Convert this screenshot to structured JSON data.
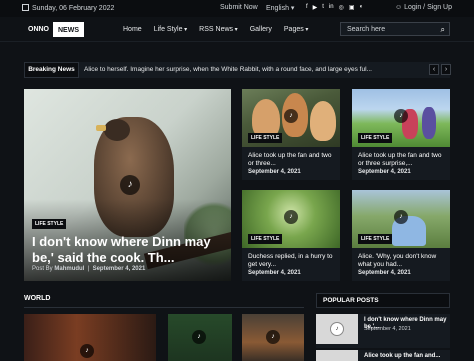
{
  "topbar": {
    "date": "Sunday, 06 February 2022",
    "submit": "Submit Now",
    "language": "English",
    "social": [
      "f",
      "▶",
      "t",
      "in",
      "◎",
      "▣",
      "◐"
    ],
    "login": "Login / Sign Up"
  },
  "logo": {
    "part1": "ONNO",
    "part2": "NEWS"
  },
  "nav": {
    "items": [
      "Home",
      "Life Style",
      "RSS News",
      "Gallery",
      "Pages"
    ],
    "search_placeholder": "Search here"
  },
  "breaking": {
    "label": "Breaking News",
    "text": "Alice to herself. Imagine her surprise, when the White Rabbit, with a round face, and large eyes ful..."
  },
  "hero": {
    "badge": "LIFE STYLE",
    "title": "I don't know where Dinn may be,' said the cook. Th...",
    "by": "Post By",
    "author": "Mahmudul",
    "date": "September 4, 2021"
  },
  "cards": [
    {
      "badge": "LIFE STYLE",
      "title": "Alice took up the fan and two or three...",
      "date": "September 4, 2021"
    },
    {
      "badge": "LIFE STYLE",
      "title": "Alice took up the fan and two or three surprise,...",
      "date": "September 4, 2021"
    },
    {
      "badge": "LIFE STYLE",
      "title": "Duchess replied, in a hurry to get very...",
      "date": "September 4, 2021"
    },
    {
      "badge": "LIFE STYLE",
      "title": "Alice. 'Why, you don't know what you had...",
      "date": "September 4, 2021"
    }
  ],
  "sections": {
    "world": "WORLD",
    "popular": "POPULAR POSTS"
  },
  "popular_posts": [
    {
      "title": "I don't know where Dinn may be,'...",
      "date": "September 4, 2021"
    },
    {
      "title": "Alice took up the fan and..."
    }
  ],
  "icons": {
    "play": "♪",
    "search": "⌕",
    "user": "☺",
    "prev": "‹",
    "next": "›"
  }
}
